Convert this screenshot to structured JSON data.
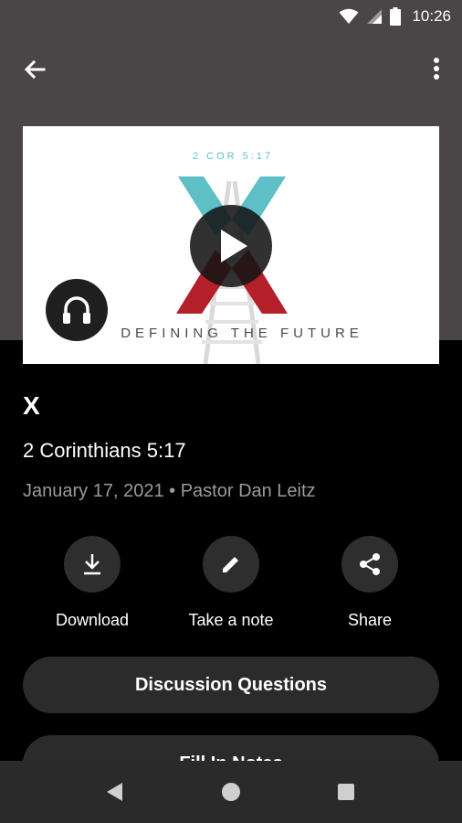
{
  "status_bar": {
    "time": "10:26"
  },
  "thumbnail": {
    "reference": "2 COR 5:17",
    "big_letter": "X",
    "tagline": "DEFINING THE FUTURE"
  },
  "sermon": {
    "title": "X",
    "scripture": "2 Corinthians 5:17",
    "date": "January 17, 2021",
    "separator": "•",
    "speaker": "Pastor Dan Leitz"
  },
  "actions": [
    {
      "label": "Download",
      "icon": "download-icon"
    },
    {
      "label": "Take a note",
      "icon": "pencil-icon"
    },
    {
      "label": "Share",
      "icon": "share-icon"
    }
  ],
  "buttons": {
    "discussion": "Discussion Questions",
    "fill_in_notes": "Fill In Notes"
  },
  "colors": {
    "header_bg": "#4a4546",
    "background": "#000000",
    "pill_bg": "#2b2b2b",
    "teal": "#5fbfc7",
    "red": "#b3202a"
  }
}
